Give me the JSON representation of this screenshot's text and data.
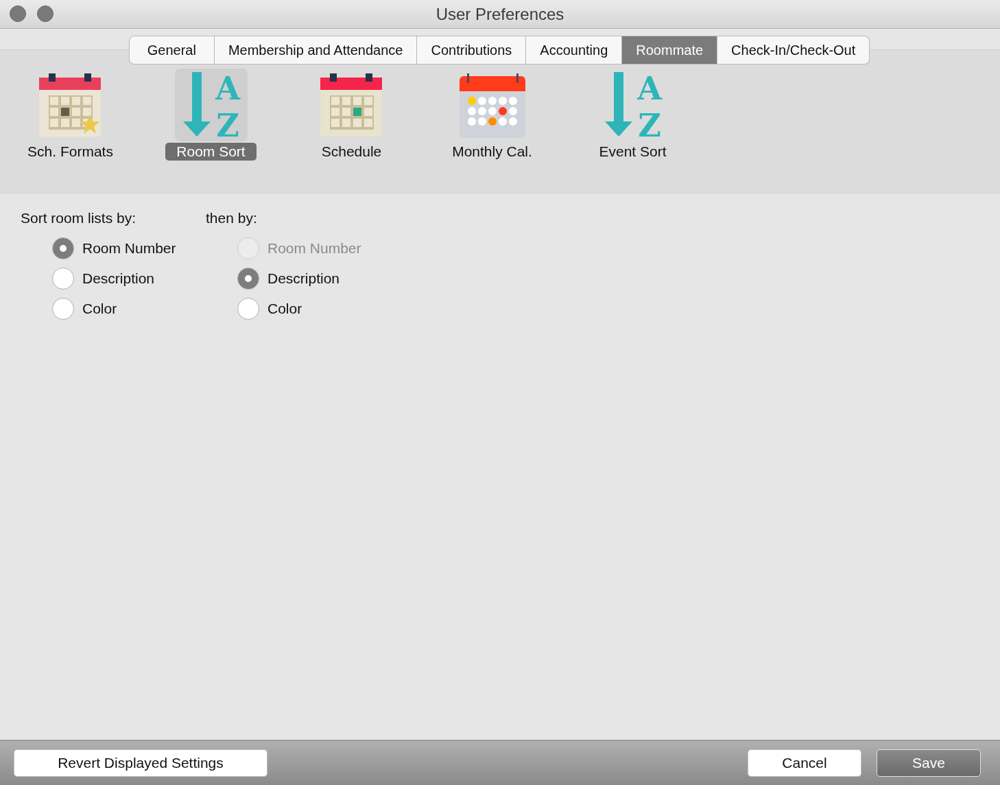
{
  "window": {
    "title": "User Preferences"
  },
  "tabs": [
    {
      "label": "General",
      "selected": false
    },
    {
      "label": "Membership and Attendance",
      "selected": false
    },
    {
      "label": "Contributions",
      "selected": false
    },
    {
      "label": "Accounting",
      "selected": false
    },
    {
      "label": "Roommate",
      "selected": true
    },
    {
      "label": "Check-In/Check-Out",
      "selected": false
    }
  ],
  "toolbar": [
    {
      "kind": "calendar-star",
      "label": "Sch. Formats",
      "selected": false
    },
    {
      "kind": "sort",
      "label": "Room Sort",
      "selected": true,
      "glyphs": [
        "A",
        "Z"
      ]
    },
    {
      "kind": "calendar",
      "label": "Schedule",
      "selected": false
    },
    {
      "kind": "monthly",
      "label": "Monthly Cal.",
      "selected": false
    },
    {
      "kind": "sort",
      "label": "Event Sort",
      "selected": false,
      "glyphs": [
        "A",
        "Z"
      ]
    }
  ],
  "groups": [
    {
      "heading": "Sort room lists by:",
      "options": [
        {
          "label": "Room Number",
          "selected": true,
          "disabled": false
        },
        {
          "label": "Description",
          "selected": false,
          "disabled": false
        },
        {
          "label": "Color",
          "selected": false,
          "disabled": false
        }
      ]
    },
    {
      "heading": "then by:",
      "options": [
        {
          "label": "Room Number",
          "selected": false,
          "disabled": true
        },
        {
          "label": "Description",
          "selected": true,
          "disabled": false
        },
        {
          "label": "Color",
          "selected": false,
          "disabled": false
        }
      ]
    }
  ],
  "buttons": {
    "revert": "Revert Displayed Settings",
    "cancel": "Cancel",
    "save": "Save"
  }
}
